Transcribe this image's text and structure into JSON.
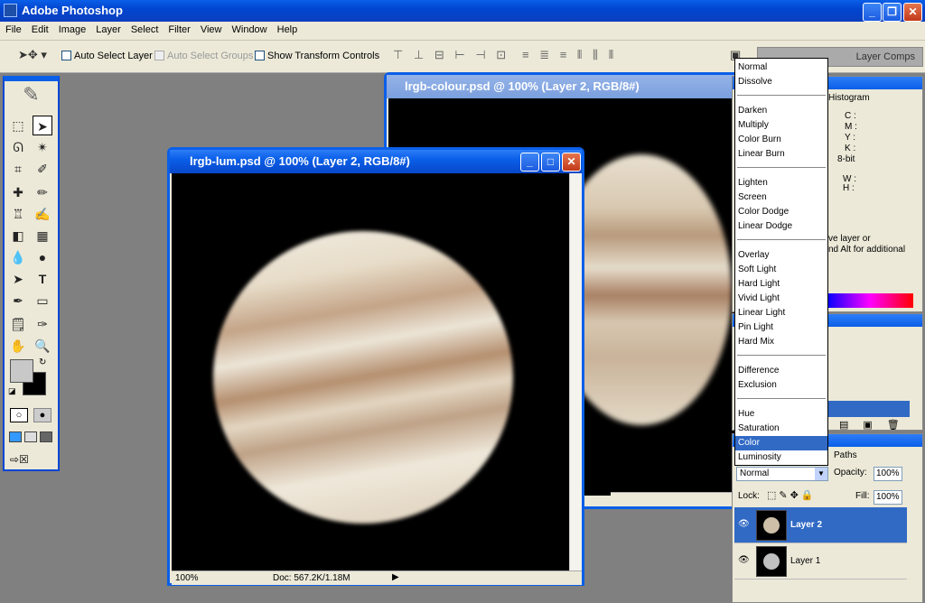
{
  "app": {
    "title": "Adobe Photoshop"
  },
  "menu": [
    "File",
    "Edit",
    "Image",
    "Layer",
    "Select",
    "Filter",
    "View",
    "Window",
    "Help"
  ],
  "options": {
    "auto_select_layer": "Auto Select Layer",
    "auto_select_groups": "Auto Select Groups",
    "show_transform": "Show Transform Controls"
  },
  "docs": {
    "back": {
      "title": "lrgb-colour.psd @ 100% (Layer 2, RGB/8#)"
    },
    "front": {
      "title": "lrgb-lum.psd @ 100% (Layer 2, RGB/8#)",
      "zoom": "100%",
      "doc_info": "Doc: 567.2K/1.18M"
    }
  },
  "panels": {
    "tab_layer_comps": "Layer Comps",
    "tab_histogram": "Histogram",
    "info": {
      "c": "C :",
      "m": "M :",
      "y": "Y :",
      "k": "K :",
      "bit": "8-bit",
      "w": "W :",
      "h": "H :"
    },
    "hint_line1": "ve layer or",
    "hint_line2": "nd Alt for additional",
    "tab_paths": "Paths"
  },
  "blend_modes": [
    "Normal",
    "Dissolve",
    "Darken",
    "Multiply",
    "Color Burn",
    "Linear Burn",
    "Lighten",
    "Screen",
    "Color Dodge",
    "Linear Dodge",
    "Overlay",
    "Soft Light",
    "Hard Light",
    "Vivid Light",
    "Linear Light",
    "Pin Light",
    "Hard Mix",
    "Difference",
    "Exclusion",
    "Hue",
    "Saturation",
    "Color",
    "Luminosity"
  ],
  "layers_panel": {
    "blend_value": "Normal",
    "opacity_label": "Opacity:",
    "opacity_value": "100%",
    "lock_label": "Lock:",
    "fill_label": "Fill:",
    "fill_value": "100%",
    "layers": [
      "Layer 2",
      "Layer 1"
    ]
  }
}
